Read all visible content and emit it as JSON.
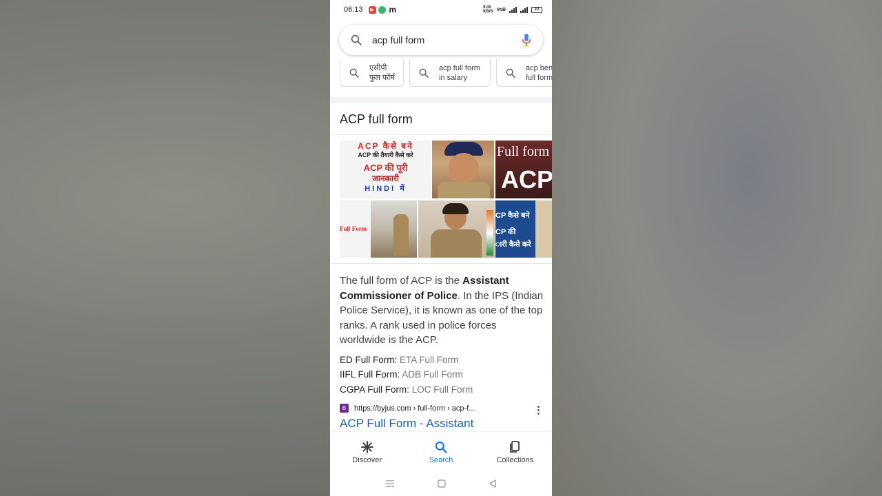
{
  "status_bar": {
    "time": "06:13",
    "battery": "22",
    "net_speed": "9.00\nKB/S"
  },
  "search": {
    "query": "acp full form"
  },
  "chips": [
    {
      "label": "एसीपी\nफुल फॉर्म"
    },
    {
      "label": "acp full form\nin salary"
    },
    {
      "label": "acp bene\nfull form"
    }
  ],
  "knowledge_panel": {
    "heading": "ACP full form",
    "images": [
      {
        "lines": [
          "ACP कैसे बने",
          "ACP की तैयारी कैसे करे",
          "ACP की पूरी",
          "जानकारी",
          "HINDI में"
        ]
      },
      {
        "caption": ""
      },
      {
        "lines": [
          "Full form",
          "ACP"
        ]
      },
      {
        "lines": [
          "Full Form"
        ]
      },
      {
        "caption": ""
      },
      {
        "lines": [
          "CP कैसे बने",
          "CP की",
          "ारी कैसे करे"
        ]
      }
    ],
    "description_pre": "The full form of ACP is the ",
    "description_bold": "Assistant Commissioner of Police",
    "description_post": ". In the IPS (Indian Police Service), it is known as one of the top ranks. A rank used in police forces worldwide is the ACP.",
    "related": [
      {
        "label": "ED Full Form:",
        "link": "ETA Full Form"
      },
      {
        "label": "IIFL Full Form:",
        "link": "ADB Full Form"
      },
      {
        "label": "CGPA Full Form:",
        "link": "LOC Full Form"
      }
    ]
  },
  "result": {
    "source_url": "https://byjus.com › full-form › acp-f...",
    "title": "ACP Full Form - Assistant"
  },
  "bottom_nav": [
    {
      "label": "Discover",
      "icon": "asterisk-icon"
    },
    {
      "label": "Search",
      "icon": "search-icon"
    },
    {
      "label": "Collections",
      "icon": "collections-icon"
    }
  ],
  "colors": {
    "accent": "#1a73e8",
    "link": "#1a5fb4",
    "muted": "#70757a"
  }
}
